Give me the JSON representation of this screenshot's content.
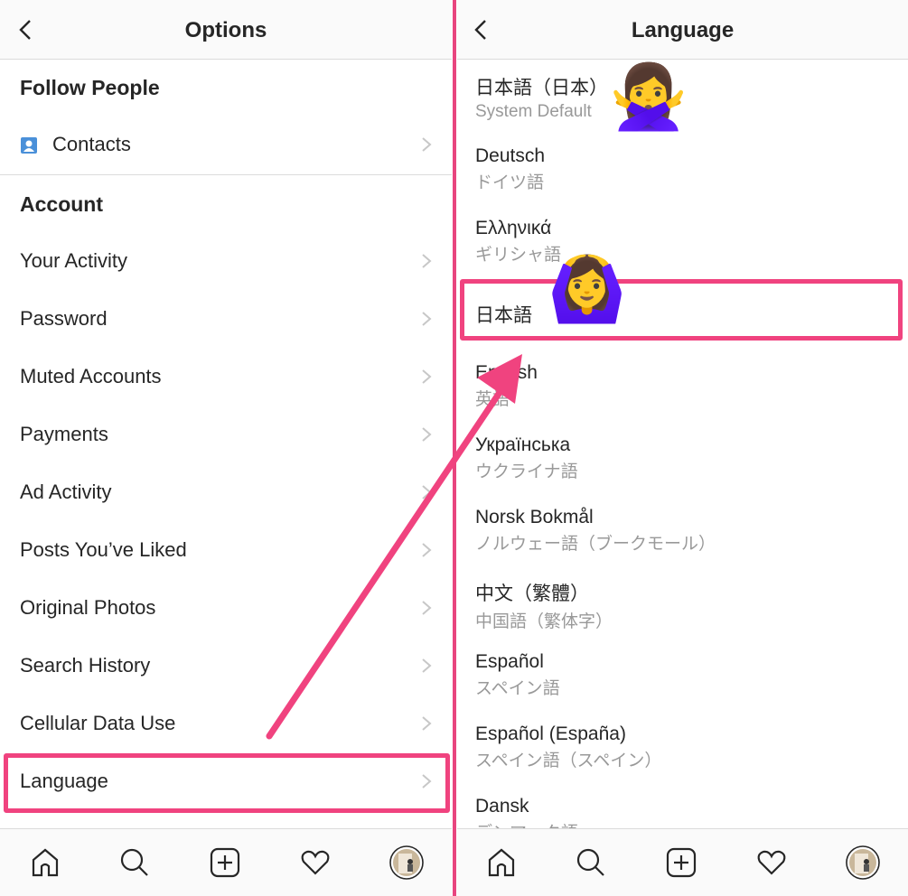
{
  "left": {
    "title": "Options",
    "sections": [
      {
        "label": "Follow People"
      },
      {
        "label": "Account"
      }
    ],
    "contacts": "Contacts",
    "items": [
      "Your Activity",
      "Password",
      "Muted Accounts",
      "Payments",
      "Ad Activity",
      "Posts You’ve Liked",
      "Original Photos",
      "Search History",
      "Cellular Data Use",
      "Language"
    ]
  },
  "right": {
    "title": "Language",
    "languages": [
      {
        "name": "日本語（日本）",
        "sub": "System Default"
      },
      {
        "name": "Deutsch",
        "sub": "ドイツ語"
      },
      {
        "name": "Ελληνικά",
        "sub": "ギリシャ語"
      },
      {
        "name": "日本語",
        "sub": ""
      },
      {
        "name": "English",
        "sub": "英語"
      },
      {
        "name": "Українська",
        "sub": "ウクライナ語"
      },
      {
        "name": "Norsk Bokmål",
        "sub": "ノルウェー語（ブークモール）"
      },
      {
        "name": "中文（繁體）",
        "sub": "中国語（繁体字）"
      },
      {
        "name": "Español",
        "sub": "スペイン語"
      },
      {
        "name": "Español (España)",
        "sub": "スペイン語（スペイン）"
      },
      {
        "name": "Dansk",
        "sub": "デンマーク語"
      }
    ]
  },
  "annotations": {
    "emoji_no": "🙅‍♀️",
    "emoji_ok": "🙆‍♀️",
    "highlight_color": "#f0437f"
  },
  "nav_icons": [
    "home-icon",
    "search-icon",
    "new-post-icon",
    "heart-icon",
    "profile-avatar"
  ]
}
